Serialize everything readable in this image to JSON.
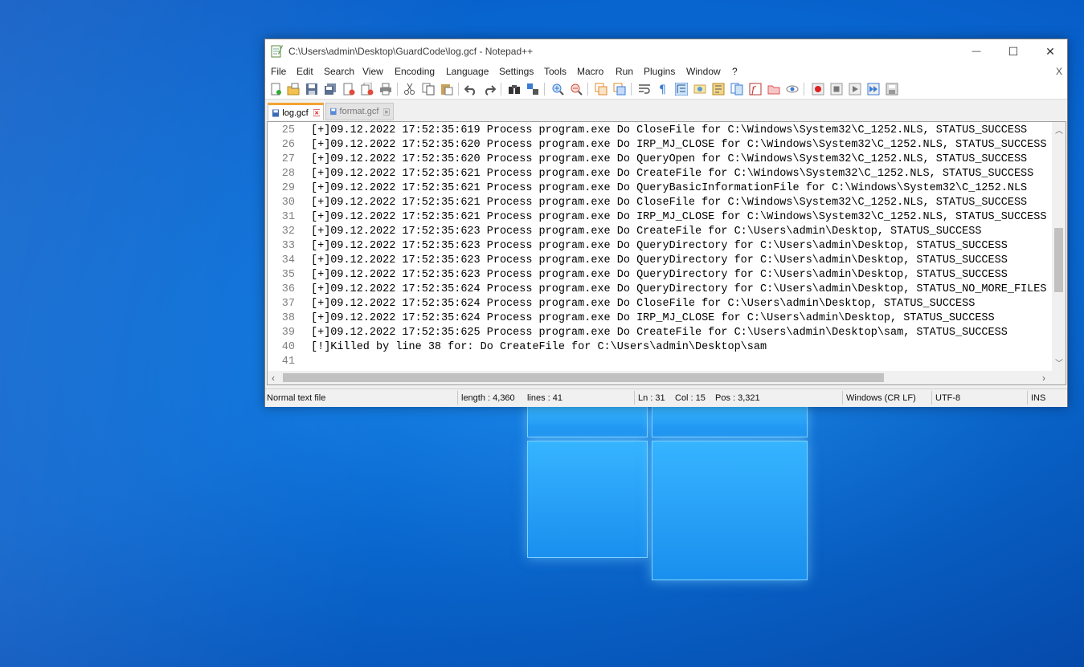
{
  "window": {
    "title": "C:\\Users\\admin\\Desktop\\GuardCode\\log.gcf - Notepad++",
    "controls": {
      "minimize": "—",
      "maximize": "☐",
      "close": "✕"
    }
  },
  "menu": {
    "items": [
      "File",
      "Edit",
      "Search",
      "View",
      "Encoding",
      "Language",
      "Settings",
      "Tools",
      "Macro",
      "Run",
      "Plugins",
      "Window",
      "?"
    ],
    "close_doc": "X"
  },
  "toolbar": {
    "icons": [
      "new-file-icon",
      "open-file-icon",
      "save-icon",
      "save-all-icon",
      "close-icon",
      "close-all-icon",
      "print-icon",
      "cut-icon",
      "copy-icon",
      "paste-icon",
      "undo-icon",
      "redo-icon",
      "find-icon",
      "replace-icon",
      "zoom-in-icon",
      "zoom-out-icon",
      "sync-v-icon",
      "sync-h-icon",
      "word-wrap-icon",
      "show-all-chars-icon",
      "indent-guide-icon",
      "udl-icon",
      "doc-map-icon",
      "doc-list-icon",
      "function-list-icon",
      "folder-workspace-icon",
      "monitoring-icon",
      "record-macro-icon",
      "stop-macro-icon",
      "play-macro-icon",
      "run-macro-multiple-icon",
      "save-macro-icon"
    ]
  },
  "tabs": [
    {
      "label": "log.gcf",
      "active": true
    },
    {
      "label": "format.gcf",
      "active": false
    }
  ],
  "editor": {
    "lines": [
      {
        "n": "25",
        "text": "[+]09.12.2022 17:52:35:619 Process program.exe Do CloseFile for C:\\Windows\\System32\\C_1252.NLS, STATUS_SUCCESS"
      },
      {
        "n": "26",
        "text": "[+]09.12.2022 17:52:35:620 Process program.exe Do IRP_MJ_CLOSE for C:\\Windows\\System32\\C_1252.NLS, STATUS_SUCCESS"
      },
      {
        "n": "27",
        "text": "[+]09.12.2022 17:52:35:620 Process program.exe Do QueryOpen for C:\\Windows\\System32\\C_1252.NLS, STATUS_SUCCESS"
      },
      {
        "n": "28",
        "text": "[+]09.12.2022 17:52:35:621 Process program.exe Do CreateFile for C:\\Windows\\System32\\C_1252.NLS, STATUS_SUCCESS"
      },
      {
        "n": "29",
        "text": "[+]09.12.2022 17:52:35:621 Process program.exe Do QueryBasicInformationFile for C:\\Windows\\System32\\C_1252.NLS"
      },
      {
        "n": "30",
        "text": "[+]09.12.2022 17:52:35:621 Process program.exe Do CloseFile for C:\\Windows\\System32\\C_1252.NLS, STATUS_SUCCESS"
      },
      {
        "n": "31",
        "text": "[+]09.12.2022 17:52:35:621 Process program.exe Do IRP_MJ_CLOSE for C:\\Windows\\System32\\C_1252.NLS, STATUS_SUCCESS"
      },
      {
        "n": "32",
        "text": "[+]09.12.2022 17:52:35:623 Process program.exe Do CreateFile for C:\\Users\\admin\\Desktop, STATUS_SUCCESS"
      },
      {
        "n": "33",
        "text": "[+]09.12.2022 17:52:35:623 Process program.exe Do QueryDirectory for C:\\Users\\admin\\Desktop, STATUS_SUCCESS"
      },
      {
        "n": "34",
        "text": "[+]09.12.2022 17:52:35:623 Process program.exe Do QueryDirectory for C:\\Users\\admin\\Desktop, STATUS_SUCCESS"
      },
      {
        "n": "35",
        "text": "[+]09.12.2022 17:52:35:623 Process program.exe Do QueryDirectory for C:\\Users\\admin\\Desktop, STATUS_SUCCESS"
      },
      {
        "n": "36",
        "text": "[+]09.12.2022 17:52:35:624 Process program.exe Do QueryDirectory for C:\\Users\\admin\\Desktop, STATUS_NO_MORE_FILES"
      },
      {
        "n": "37",
        "text": "[+]09.12.2022 17:52:35:624 Process program.exe Do CloseFile for C:\\Users\\admin\\Desktop, STATUS_SUCCESS"
      },
      {
        "n": "38",
        "text": "[+]09.12.2022 17:52:35:624 Process program.exe Do IRP_MJ_CLOSE for C:\\Users\\admin\\Desktop, STATUS_SUCCESS"
      },
      {
        "n": "39",
        "text": "[+]09.12.2022 17:52:35:625 Process program.exe Do CreateFile for C:\\Users\\admin\\Desktop\\sam, STATUS_SUCCESS"
      },
      {
        "n": "40",
        "text": "[!]Killed by line 38 for: Do CreateFile for C:\\Users\\admin\\Desktop\\sam"
      },
      {
        "n": "41",
        "text": ""
      }
    ]
  },
  "status": {
    "file_type": "Normal text file",
    "length": "length : 4,360",
    "lines": "lines : 41",
    "ln": "Ln : 31",
    "col": "Col : 15",
    "pos": "Pos : 3,321",
    "eol": "Windows (CR LF)",
    "encoding": "UTF-8",
    "mode": "INS"
  },
  "colors": {
    "tab_accent": "#f4a330",
    "desktop_blue": "#0a6fd8"
  }
}
